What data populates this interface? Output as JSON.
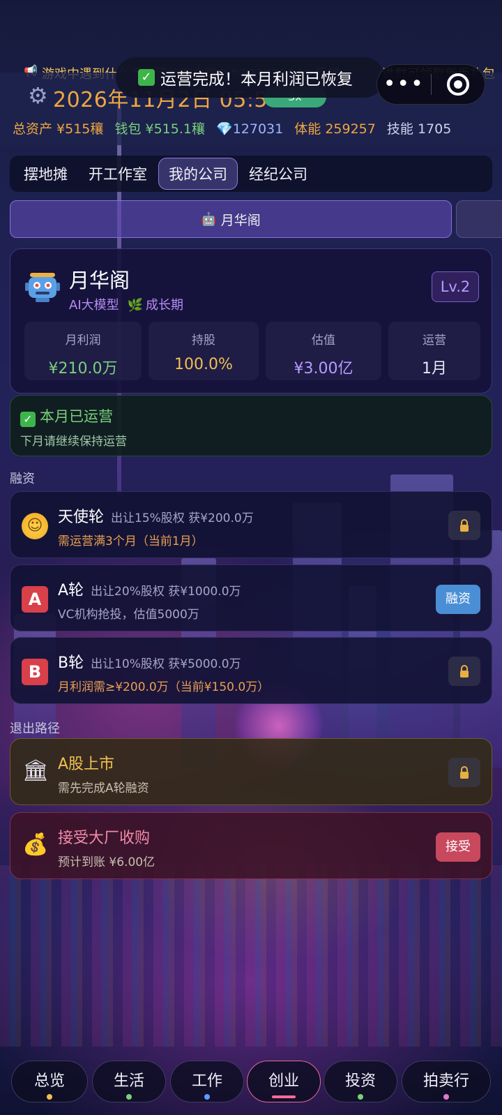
{
  "ticker": {
    "text": "游戏中遇到什么问题可加客户群Q 9393773849 反馈",
    "tail": "进群可领取新手礼包"
  },
  "toast": {
    "text": "运营完成！本月利润已恢复"
  },
  "header": {
    "datetime": "2026年11月2日 05:50",
    "speed": "3x",
    "total_assets": "总资产 ¥515穰",
    "wallet": "钱包 ¥515.1穰",
    "gems": "127031",
    "energy": "体能 259257",
    "skill": "技能 1705"
  },
  "tabs": [
    "摆地摊",
    "开工作室",
    "我的公司",
    "经纪公司"
  ],
  "active_tab": "我的公司",
  "company_selector": {
    "label": "月华阁"
  },
  "company": {
    "name": "月华阁",
    "industry": "AI大模型",
    "stage": "成长期",
    "level": "Lv.2",
    "metrics": [
      {
        "label": "月利润",
        "value": "¥210.0万"
      },
      {
        "label": "持股",
        "value": "100.0%"
      },
      {
        "label": "估值",
        "value": "¥3.00亿"
      },
      {
        "label": "运营",
        "value": "1月"
      }
    ]
  },
  "operation_status": {
    "title": "本月已运营",
    "subtitle": "下月请继续保持运营"
  },
  "financing": {
    "section_label": "融资",
    "rounds": [
      {
        "icon": "angel-face-icon",
        "name": "天使轮",
        "deal": "出让15%股权 获¥200.0万",
        "note": "需运营满3个月（当前1月）",
        "locked": true
      },
      {
        "icon": "letter-a-icon",
        "letter": "A",
        "name": "A轮",
        "deal": "出让20%股权 获¥1000.0万",
        "note": "VC机构抢投，估值5000万",
        "locked": false,
        "button": "融资"
      },
      {
        "icon": "letter-b-icon",
        "letter": "B",
        "name": "B轮",
        "deal": "出让10%股权 获¥5000.0万",
        "note": "月利润需≥¥200.0万（当前¥150.0万）",
        "locked": true
      }
    ]
  },
  "exit": {
    "section_label": "退出路径",
    "ipo": {
      "title": "A股上市",
      "note": "需先完成A轮融资",
      "locked": true
    },
    "acquisition": {
      "title": "接受大厂收购",
      "note": "预计到账 ¥6.00亿",
      "button": "接受"
    }
  },
  "bottom_nav": {
    "items": [
      "总览",
      "生活",
      "工作",
      "创业",
      "投资",
      "拍卖行"
    ],
    "active": "创业",
    "dot_colors": [
      "#f0c050",
      "#7ad07a",
      "#5a9fff",
      "#ff6a9a",
      "#7ad07a",
      "#e07ad0"
    ]
  },
  "colors": {
    "accent_purple": "#8d7be0",
    "profit_green": "#7ad07a",
    "warn_orange": "#e8a050",
    "finance_blue": "#4a8fd6",
    "accept_red": "#c8485e"
  }
}
